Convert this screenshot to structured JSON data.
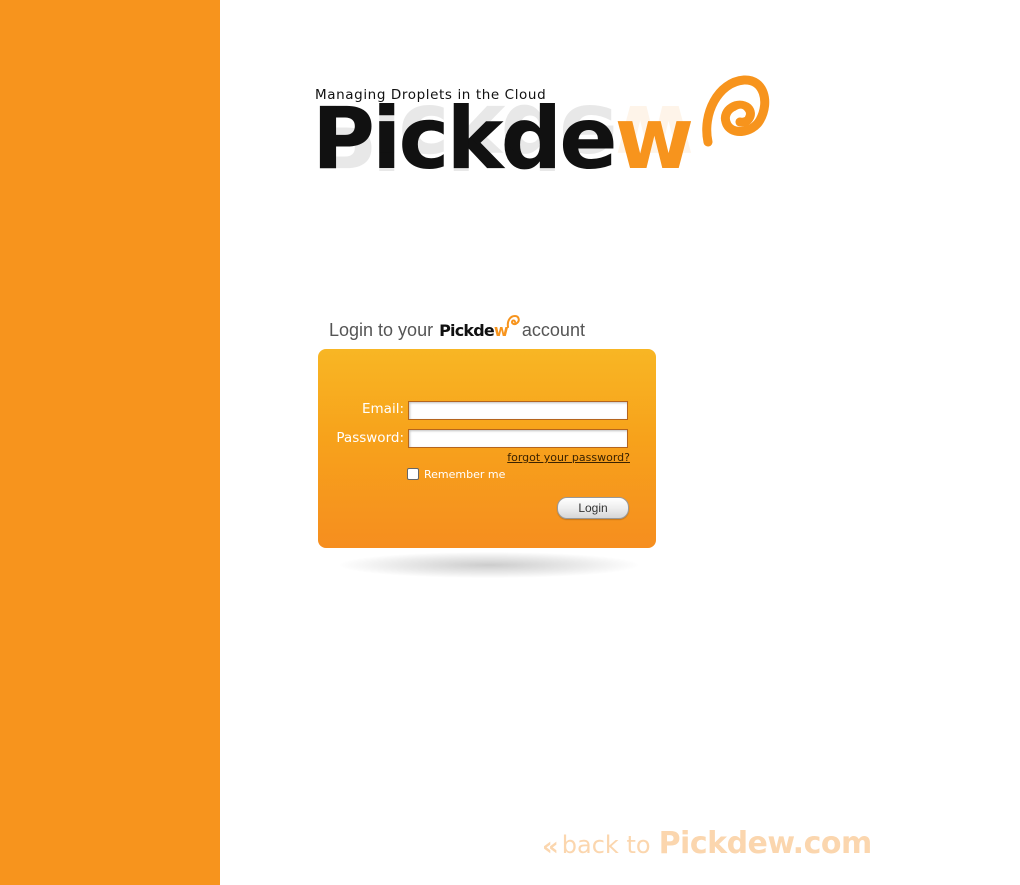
{
  "logo": {
    "tagline": "Managing Droplets in the Cloud",
    "wordmark_main": "Pickde",
    "wordmark_accent": "w"
  },
  "login_heading": {
    "prefix": "Login to your",
    "brand_main": "Pickde",
    "brand_accent": "w",
    "suffix": "account"
  },
  "form": {
    "email_label": "Email:",
    "email_value": "",
    "password_label": "Password:",
    "password_value": "",
    "forgot_link": "forgot your password?",
    "remember_label": "Remember me",
    "remember_checked": false,
    "login_button": "Login"
  },
  "footer": {
    "back_arrows": "«",
    "back_text": "back to",
    "back_domain": "Pickdew.com"
  },
  "colors": {
    "brand_orange": "#f7941d",
    "panel_top": "#f8b624",
    "panel_bottom": "#f68e1f",
    "back_link": "#fbd6ae"
  }
}
